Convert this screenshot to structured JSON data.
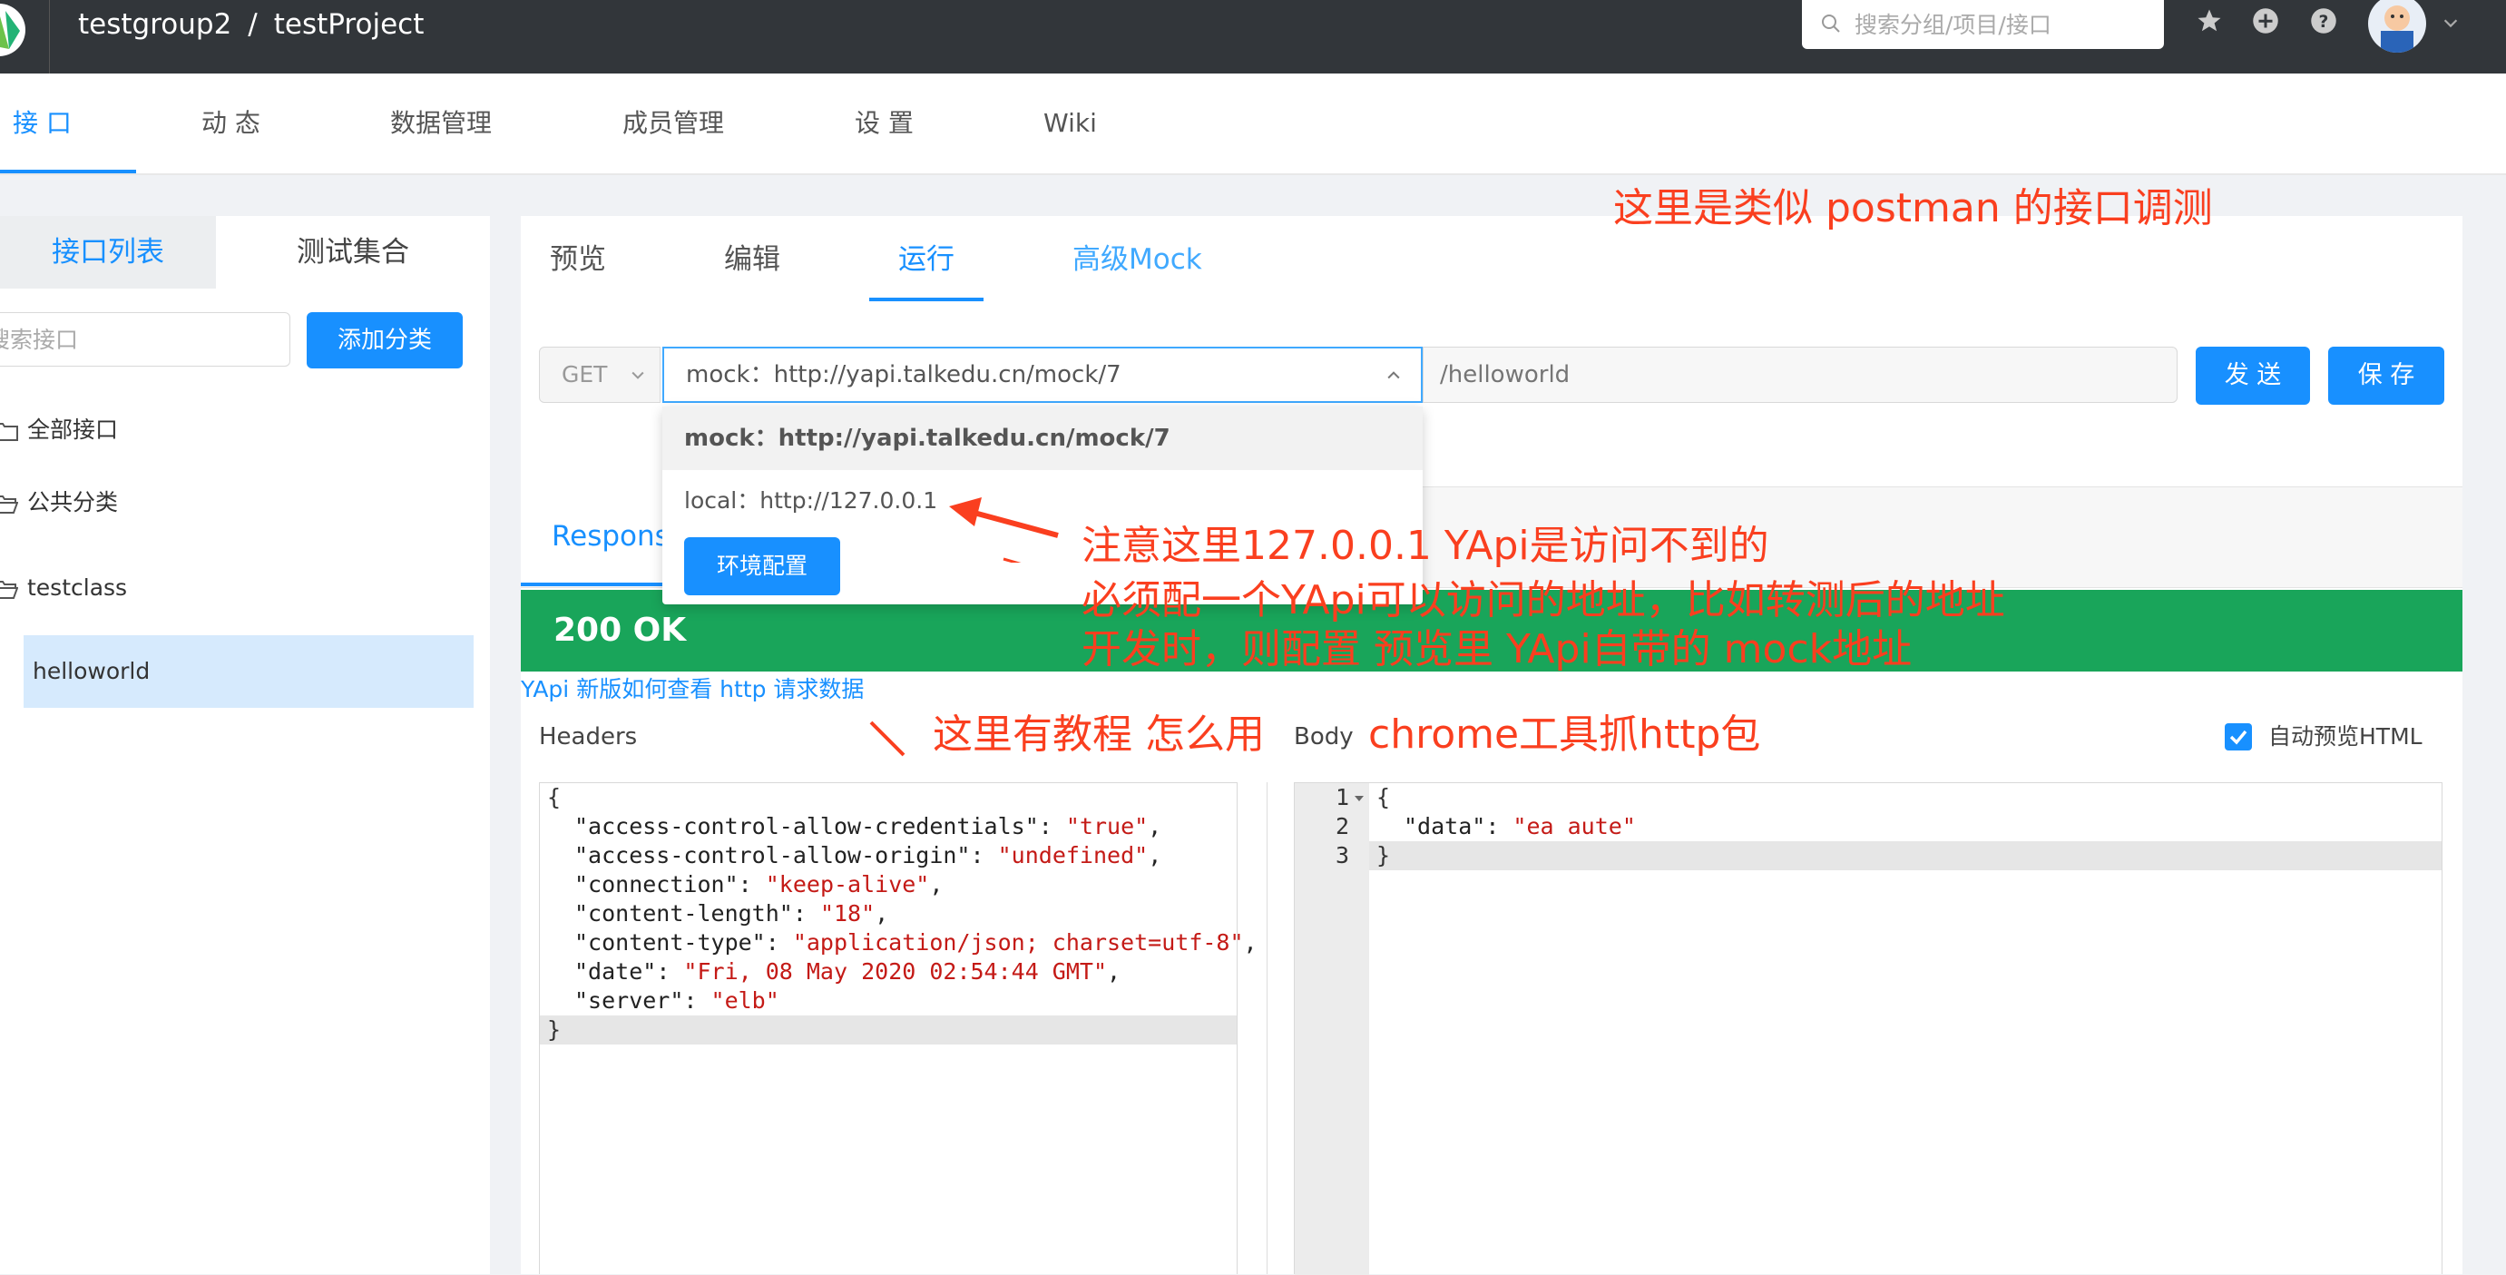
{
  "header": {
    "group": "testgroup2",
    "separator": "/",
    "project": "testProject",
    "search_placeholder": "搜索分组/项目/接口",
    "icons": [
      "star-icon",
      "plus-circle-icon",
      "question-circle-icon",
      "avatar",
      "chevron-down-icon"
    ]
  },
  "nav": {
    "tabs": [
      {
        "label": "接 口",
        "active": true
      },
      {
        "label": "动 态"
      },
      {
        "label": "数据管理"
      },
      {
        "label": "成员管理"
      },
      {
        "label": "设 置"
      },
      {
        "label": "Wiki"
      }
    ]
  },
  "sidebar": {
    "tab_list": "接口列表",
    "tab_collection": "测试集合",
    "search_placeholder": "搜索接口",
    "add_category": "添加分类",
    "tree": [
      {
        "label": "全部接口"
      },
      {
        "label": "公共分类"
      },
      {
        "label": "testclass"
      }
    ],
    "selected_interface": "helloworld"
  },
  "main": {
    "tabs": [
      {
        "label": "预览"
      },
      {
        "label": "编辑"
      },
      {
        "label": "运行",
        "active": true
      },
      {
        "label": "高级Mock"
      }
    ],
    "method": "GET",
    "env_selected": "mock：http://yapi.talkedu.cn/mock/7",
    "path_placeholder": "/helloworld",
    "send_label": "发 送",
    "save_label": "保 存",
    "env_options": [
      "mock：http://yapi.talkedu.cn/mock/7",
      "local：http://127.0.0.1"
    ],
    "env_config_label": "环境配置",
    "response_tab": "Respons",
    "status": "200 OK",
    "doc_link": "YApi 新版如何查看 http 请求数据",
    "headers_label": "Headers",
    "body_label": "Body",
    "auto_preview_label": "自动预览HTML",
    "auto_preview_checked": true,
    "headers_code": {
      "open": "{",
      "close": "}",
      "lines": [
        {
          "key": "\"access-control-allow-credentials\"",
          "value": "\"true\"",
          "comma": ","
        },
        {
          "key": "\"access-control-allow-origin\"",
          "value": "\"undefined\"",
          "comma": ","
        },
        {
          "key": "\"connection\"",
          "value": "\"keep-alive\"",
          "comma": ","
        },
        {
          "key": "\"content-length\"",
          "value": "\"18\"",
          "comma": ","
        },
        {
          "key": "\"content-type\"",
          "value": "\"application/json; charset=utf-8\"",
          "comma": ","
        },
        {
          "key": "\"date\"",
          "value": "\"Fri, 08 May 2020 02:54:44 GMT\"",
          "comma": ","
        },
        {
          "key": "\"server\"",
          "value": "\"elb\"",
          "comma": ""
        }
      ]
    },
    "body_code": {
      "line_numbers": [
        "1",
        "2",
        "3"
      ],
      "open": "{",
      "key": "\"data\"",
      "value": "\"ea aute\"",
      "close": "}"
    }
  },
  "annotations": {
    "top_note": "这里是类似 postman 的接口调测",
    "warn_line1": "注意这里127.0.0.1 YApi是访问不到的",
    "warn_line2": "必须配一个YApi可以访问的地址，比如转测后的地址",
    "warn_line3": "开发时，则配置 预览里 YApi自带的 mock地址",
    "tutorial_note": "这里有教程 怎么用",
    "chrome_note": "chrome工具抓http包",
    "color": "#fa3f1f"
  }
}
